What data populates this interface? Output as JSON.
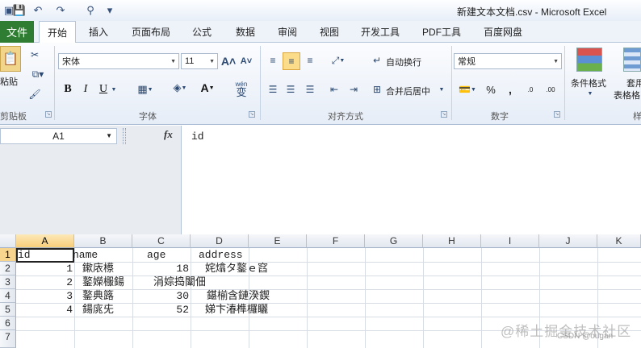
{
  "window": {
    "title": "新建文本文档.csv  -  Microsoft Excel"
  },
  "tabs": {
    "file": "文件",
    "home": "开始",
    "insert": "插入",
    "layout": "页面布局",
    "formulas": "公式",
    "data": "数据",
    "review": "审阅",
    "view": "视图",
    "developer": "开发工具",
    "pdf": "PDF工具",
    "baidu": "百度网盘"
  },
  "ribbon": {
    "clipboard": {
      "paste": "粘贴",
      "label": "剪贴板"
    },
    "font": {
      "name": "宋体",
      "size": "11",
      "label": "字体",
      "grow": "A",
      "shrink": "A",
      "bold": "B",
      "italic": "I",
      "underline": "U",
      "colorA": "A",
      "wen": "wén",
      "wen_char": "变"
    },
    "alignment": {
      "wrap": "自动换行",
      "merge": "合并后居中",
      "label": "对齐方式"
    },
    "number": {
      "format": "常规",
      "percent": "%",
      "comma": ",",
      "dec1": ".0",
      "dec2": ".00",
      "label": "数字"
    },
    "styles": {
      "cond": "条件格式",
      "table_line1": "套用",
      "table_line2": "表格格",
      "label": "样"
    }
  },
  "formula_bar": {
    "name_box": "A1",
    "fx": "fx",
    "content": "id"
  },
  "sheet": {
    "columns": [
      "A",
      "B",
      "C",
      "D",
      "E",
      "F",
      "G",
      "H",
      "I",
      "J",
      "K"
    ],
    "rows": [
      "1",
      "2",
      "3",
      "4",
      "5",
      "6",
      "7"
    ],
    "cells": [
      {
        "id": "a1",
        "value": "id"
      },
      {
        "id": "b1",
        "value": "name"
      },
      {
        "id": "c1",
        "value": "age"
      },
      {
        "id": "d1",
        "value": "address"
      },
      {
        "id": "a2",
        "value": "1"
      },
      {
        "id": "b2",
        "value": "鏉庡櫒"
      },
      {
        "id": "c2",
        "value": "18"
      },
      {
        "id": "d2",
        "value": "姹熻タ鐜ｅ窞"
      },
      {
        "id": "a3",
        "value": "2"
      },
      {
        "id": "b3",
        "value": "鐜嬫棴鍚"
      },
      {
        "id": "c3",
        "value": "涓婃捣闈佃"
      },
      {
        "id": "a4",
        "value": "3"
      },
      {
        "id": "b4",
        "value": "鐜典簬"
      },
      {
        "id": "c4",
        "value": "30"
      },
      {
        "id": "d4",
        "value": "鍖椾含鏈湀鍥"
      },
      {
        "id": "a5",
        "value": "4"
      },
      {
        "id": "b5",
        "value": "鍚庣兂"
      },
      {
        "id": "c5",
        "value": "52"
      },
      {
        "id": "d5",
        "value": "娣卞湷榫欏矖"
      }
    ]
  },
  "watermark": {
    "main": "@稀土掘金技术社区",
    "sub": "CSDN @ougan"
  }
}
